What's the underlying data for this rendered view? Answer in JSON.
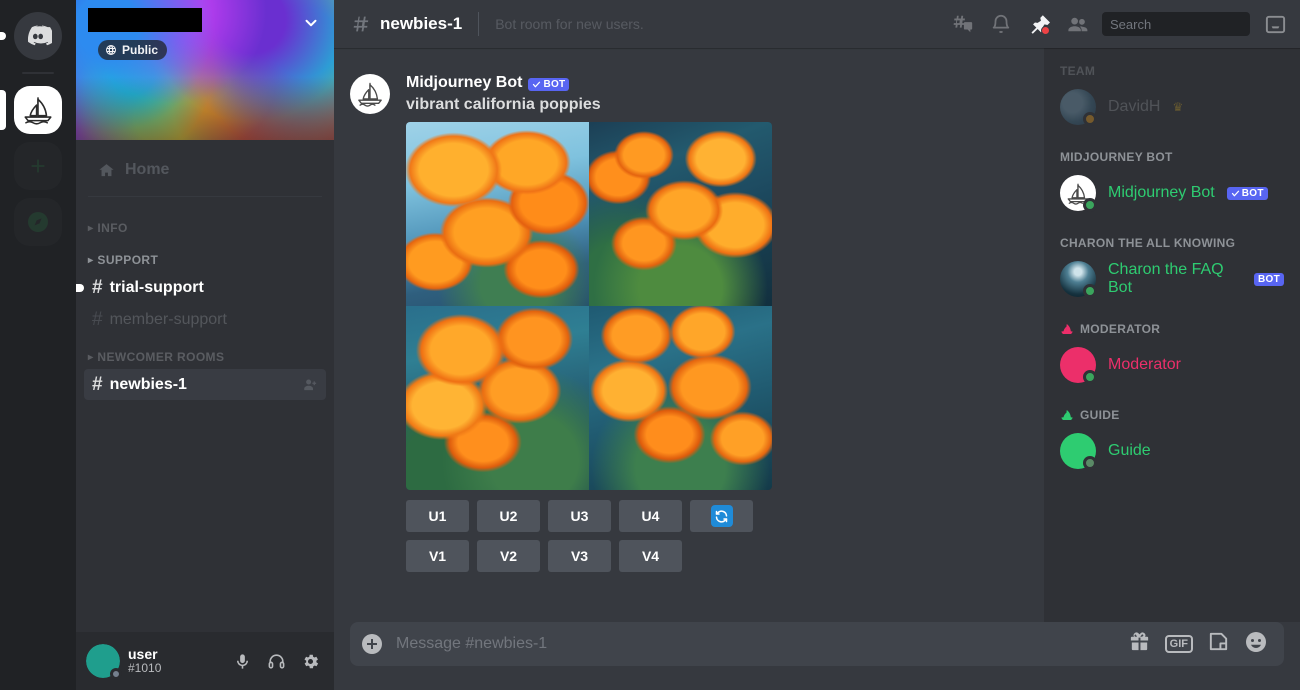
{
  "colors": {
    "blurple": "#5865f2",
    "online_green": "#3ba55d",
    "member_green": "#2ecc71",
    "moderator_pink": "#ec2f6a",
    "guide_green": "#2ecc71",
    "red_badge": "#ed4245",
    "reroll_blue": "#1f8bd8"
  },
  "rail": {
    "items": [
      {
        "name": "home",
        "icon": "discord-logo-icon",
        "label": "Home"
      },
      {
        "name": "midjourney",
        "icon": "sailboat-icon",
        "label": "Midjourney",
        "active": true
      },
      {
        "name": "add-server",
        "icon": "plus-icon",
        "label": "Add a Server"
      },
      {
        "name": "explore",
        "icon": "compass-icon",
        "label": "Explore Public Servers"
      }
    ]
  },
  "sidebar": {
    "server_name": "",
    "public_badge": "Public",
    "home_label": "Home",
    "categories": [
      {
        "label": "INFO",
        "dim": true,
        "channels": []
      },
      {
        "label": "SUPPORT",
        "dim": false,
        "channels": [
          {
            "name": "trial-support",
            "state": "unread",
            "icon": "hash-icon"
          },
          {
            "name": "member-support",
            "state": "muted",
            "icon": "hash-thread-icon"
          }
        ]
      },
      {
        "label": "NEWCOMER ROOMS",
        "dim": true,
        "channels": [
          {
            "name": "newbies-1",
            "state": "selected",
            "icon": "hash-lock-icon"
          }
        ]
      }
    ]
  },
  "user_panel": {
    "username": "user",
    "discriminator": "#1010",
    "mic_icon": "microphone-icon",
    "headphones_icon": "headphones-icon",
    "settings_icon": "gear-icon"
  },
  "topbar": {
    "channel_name": "newbies-1",
    "topic": "Bot room for new users.",
    "icons": [
      {
        "name": "threads-icon",
        "state": "dim"
      },
      {
        "name": "bell-icon",
        "state": "dim"
      },
      {
        "name": "pin-icon",
        "state": "active",
        "badge": true
      },
      {
        "name": "members-icon",
        "state": "dim"
      },
      {
        "name": "inbox-icon",
        "state": "dim"
      }
    ],
    "search_placeholder": "Search",
    "search_value": ""
  },
  "message": {
    "author": "Midjourney Bot",
    "bot_badge": "BOT",
    "prompt": "vibrant california poppies",
    "avatar_icon": "sailboat-icon",
    "image_grid": [
      {
        "alt": "poppies variation 1"
      },
      {
        "alt": "poppies variation 2"
      },
      {
        "alt": "poppies variation 3"
      },
      {
        "alt": "poppies variation 4"
      }
    ],
    "upscale_buttons": [
      "U1",
      "U2",
      "U3",
      "U4"
    ],
    "reroll_icon": "refresh-icon",
    "variation_buttons": [
      "V1",
      "V2",
      "V3",
      "V4"
    ]
  },
  "composer": {
    "placeholder": "Message #newbies-1",
    "value": "",
    "plus_icon": "plus-circle-icon",
    "icons": [
      "gift-icon",
      "gif-icon",
      "sticker-icon",
      "emoji-icon"
    ],
    "gif_label": "GIF"
  },
  "members": {
    "groups": [
      {
        "label": "TEAM",
        "dim": true,
        "icon": null,
        "people": [
          {
            "name": "DavidH",
            "color": "#8e9297",
            "status": "idle",
            "crown": true,
            "badge": null,
            "avatar": "photo",
            "dim": true
          }
        ]
      },
      {
        "label": "MIDJOURNEY BOT",
        "dim": false,
        "icon": null,
        "people": [
          {
            "name": "Midjourney Bot",
            "color": "#2ecc71",
            "status": "online",
            "crown": false,
            "badge": "BOT",
            "badge_check": true,
            "avatar": "sailboat"
          }
        ]
      },
      {
        "label": "CHARON THE ALL KNOWING",
        "dim": false,
        "icon": null,
        "people": [
          {
            "name": "Charon the FAQ Bot",
            "color": "#2ecc71",
            "status": "online",
            "crown": false,
            "badge": "BOT",
            "badge_check": false,
            "avatar": "charon"
          }
        ]
      },
      {
        "label": "MODERATOR",
        "dim": false,
        "icon": "boat-pink-icon",
        "people": [
          {
            "name": "Moderator",
            "color": "#ec2f6a",
            "status": "online",
            "crown": false,
            "badge": null,
            "avatar": "pink"
          }
        ]
      },
      {
        "label": "GUIDE",
        "dim": false,
        "icon": "boat-green-icon",
        "people": [
          {
            "name": "Guide",
            "color": "#2ecc71",
            "status": "idle",
            "crown": false,
            "badge": null,
            "avatar": "green"
          }
        ]
      }
    ]
  }
}
